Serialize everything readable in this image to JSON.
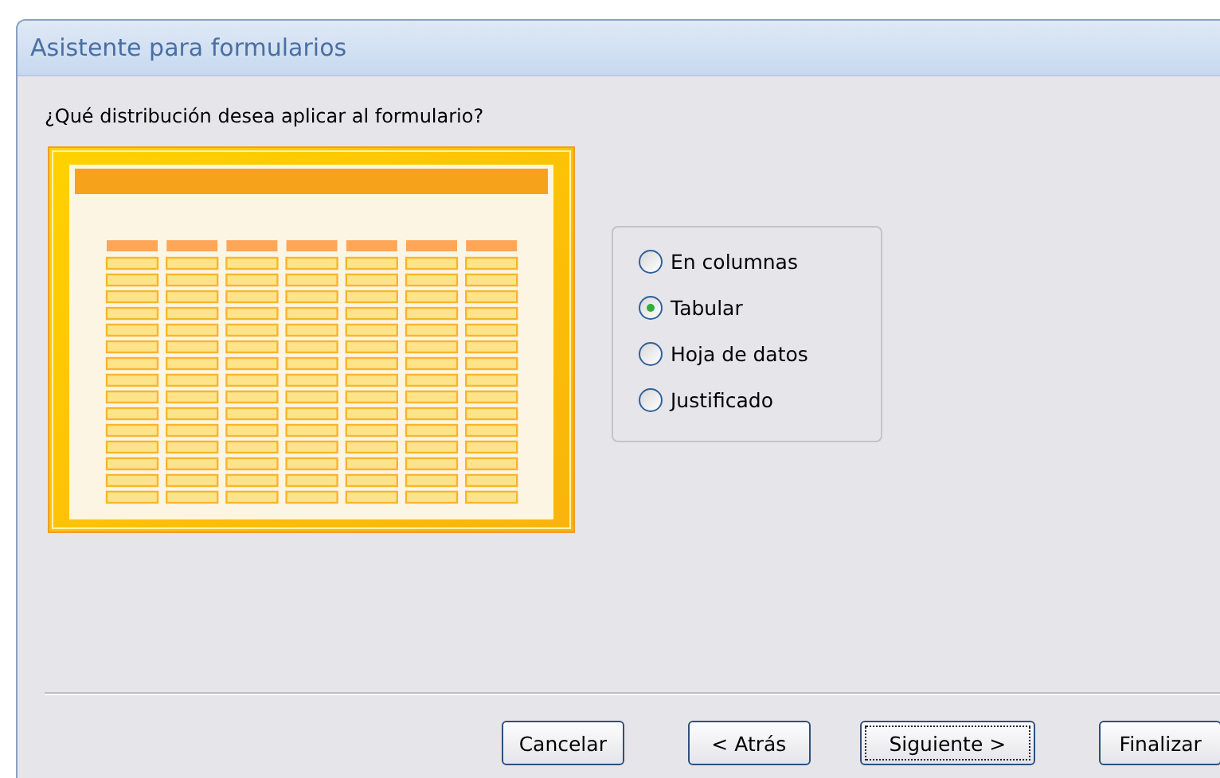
{
  "window": {
    "title": "Asistente para formularios"
  },
  "question": "¿Qué distribución desea aplicar al formulario?",
  "options": [
    {
      "label": "En columnas",
      "selected": false
    },
    {
      "label": "Tabular",
      "selected": true
    },
    {
      "label": "Hoja de datos",
      "selected": false
    },
    {
      "label": "Justificado",
      "selected": false
    }
  ],
  "buttons": [
    {
      "label": "Cancelar",
      "focused": false
    },
    {
      "label": "< Atrás",
      "focused": false
    },
    {
      "label": "Siguiente >",
      "focused": true
    },
    {
      "label": "Finalizar",
      "focused": false
    }
  ]
}
